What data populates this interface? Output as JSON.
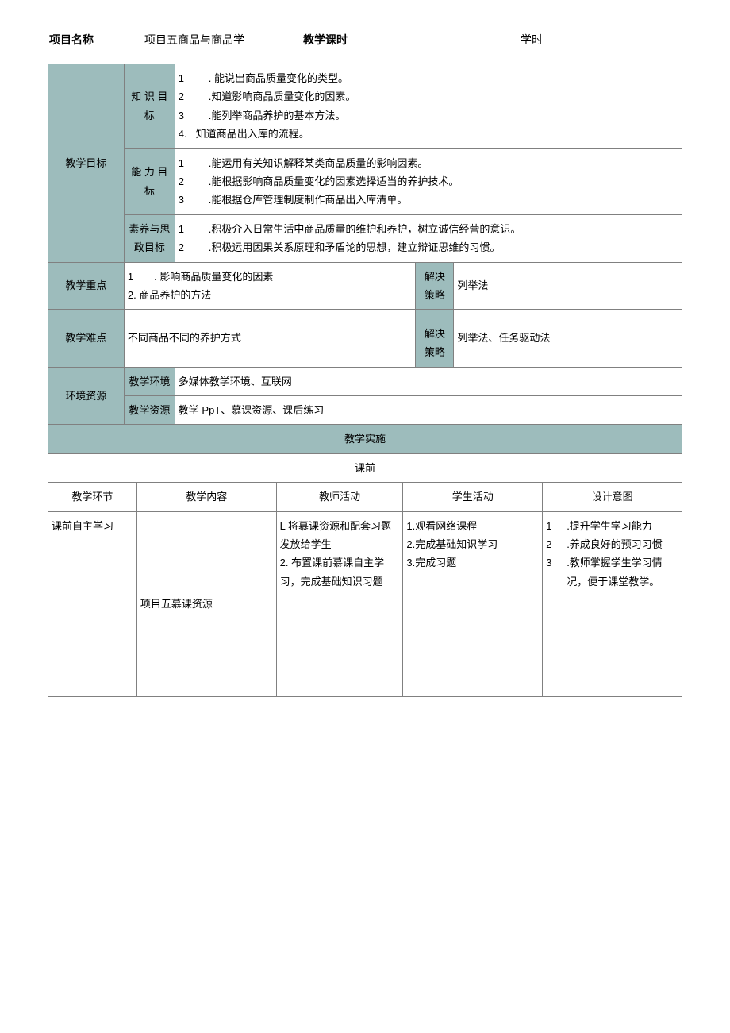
{
  "header": {
    "label_project": "项目名称",
    "value_project": "项目五商品与商品学",
    "label_hours": "教学课时",
    "value_hours": "学时"
  },
  "goals": {
    "section_label": "教学目标",
    "knowledge": {
      "label": "知 识 目标",
      "items": [
        {
          "n": "1",
          "t": ". 能说出商品质量变化的类型。"
        },
        {
          "n": "2",
          "t": ".知道影响商品质量变化的因素。"
        },
        {
          "n": "3",
          "t": ".能列举商品养护的基本方法。"
        },
        {
          "n": "4.",
          "t": "知道商品出入库的流程。"
        }
      ]
    },
    "ability": {
      "label": "能 力 目标",
      "items": [
        {
          "n": "1",
          "t": ".能运用有关知识解释某类商品质量的影响因素。"
        },
        {
          "n": "2",
          "t": ".能根据影响商品质量变化的因素选择适当的养护技术。"
        },
        {
          "n": "3",
          "t": ".能根据仓库管理制度制作商品出入库清单。"
        }
      ]
    },
    "quality": {
      "label": "素养与思政目标",
      "items": [
        {
          "n": "1",
          "t": ".积极介入日常生活中商品质量的维护和养护，树立诚信经营的意识。"
        },
        {
          "n": "2",
          "t": ".积极运用因果关系原理和矛盾论的思想，建立辩证思维的习惯。"
        }
      ]
    }
  },
  "keypoint": {
    "label": "教学重点",
    "content_lines": [
      "1　　. 影响商品质量变化的因素",
      "2. 商品养护的方法"
    ],
    "strategy_label": "解决策略",
    "strategy_value": "列举法"
  },
  "difficulty": {
    "label": "教学难点",
    "content": "不同商品不同的养护方式",
    "strategy_label": "解决策略",
    "strategy_value": "列举法、任务驱动法"
  },
  "env": {
    "label": "环境资源",
    "env_label": "教学环境",
    "env_value": "多媒体教学环境、互联网",
    "res_label": "教学资源",
    "res_value": "教学 PpT、慕课资源、课后练习"
  },
  "impl": {
    "title": "教学实施",
    "pre_title": "课前",
    "columns": {
      "c1": "教学环节",
      "c2": "教学内容",
      "c3": "教师活动",
      "c4": "学生活动",
      "c5": "设计意图"
    },
    "row1": {
      "c1": "课前自主学习",
      "c2": "项目五慕课资源",
      "c3_lines": [
        "L 将慕课资源和配套习题发放给学生",
        "2. 布置课前慕课自主学习，完成基础知识习题"
      ],
      "c4_lines": [
        "1.观看网络课程",
        "2.完成基础知识学习",
        "3.完成习题"
      ],
      "c5_items": [
        {
          "n": "1",
          "t": ".提升学生学习能力"
        },
        {
          "n": "2",
          "t": ".养成良好的预习习惯"
        },
        {
          "n": "3",
          "t": ".教师掌握学生学习情况，便于课堂教学。"
        }
      ]
    }
  }
}
